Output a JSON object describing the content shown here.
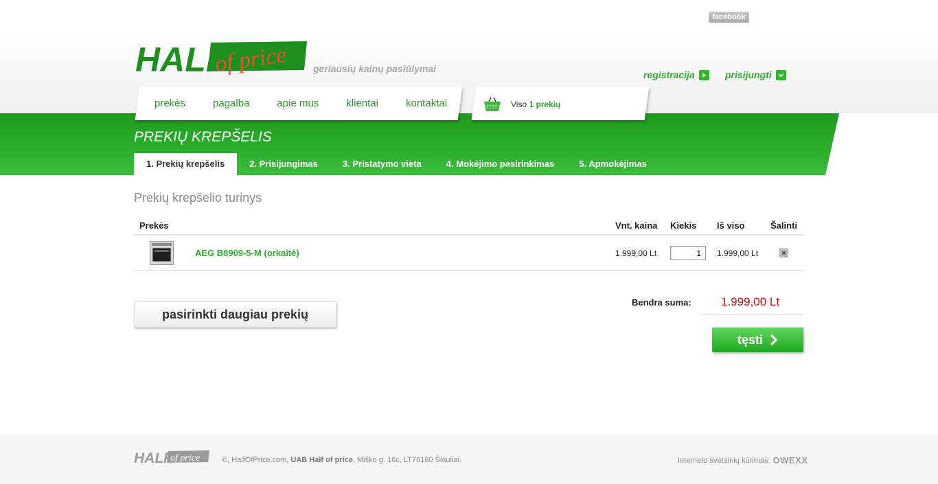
{
  "header": {
    "facebook_label": "facebook",
    "logo_text_1": "HALF",
    "logo_text_2": "of price",
    "tagline": "geriausių kainų pasiūlymai",
    "register_label": "registracija",
    "login_label": "prisijungti"
  },
  "nav": {
    "items": [
      "prekės",
      "pagalba",
      "apie mus",
      "klientai",
      "kontaktai"
    ]
  },
  "cart": {
    "prefix": "Viso",
    "count_label": "1 prekių"
  },
  "page": {
    "title": "PREKIŲ KREPŠELIS",
    "steps": [
      "1. Prekių krepšelis",
      "2. Prisijungimas",
      "3. Pristatymo vieta",
      "4. Mokėjimo pasirinkimas",
      "5. Apmokėjimas"
    ],
    "active_step": 0,
    "section_title": "Prekių krepšelio turinys"
  },
  "table": {
    "headers": {
      "product": "Prekės",
      "unit_price": "Vnt. kaina",
      "qty": "Kiekis",
      "total": "Iš viso",
      "remove": "Šalinti"
    },
    "rows": [
      {
        "name": "AEG B8909-5-M (orkaitė)",
        "unit_price": "1.999,00 Lt",
        "qty": "1",
        "total": "1.999,00 Lt"
      }
    ]
  },
  "summary": {
    "label": "Bendra suma:",
    "value": "1.999,00 Lt"
  },
  "actions": {
    "more_label": "pasirinkti daugiau prekių",
    "next_label": "tęsti"
  },
  "footer": {
    "copy_prefix": "©, HalfOfPrice.com, ",
    "company": "UAB Half of price",
    "copy_suffix": ", Miško g. 16c, LT76180 Šiauliai.",
    "credit": "Interneto svetainių kūrimas:",
    "credit_brand": "OWEXX"
  },
  "colors": {
    "accent_green": "#2fa92f",
    "band_green": "#1e9a1e",
    "sum_red": "#c81010"
  }
}
